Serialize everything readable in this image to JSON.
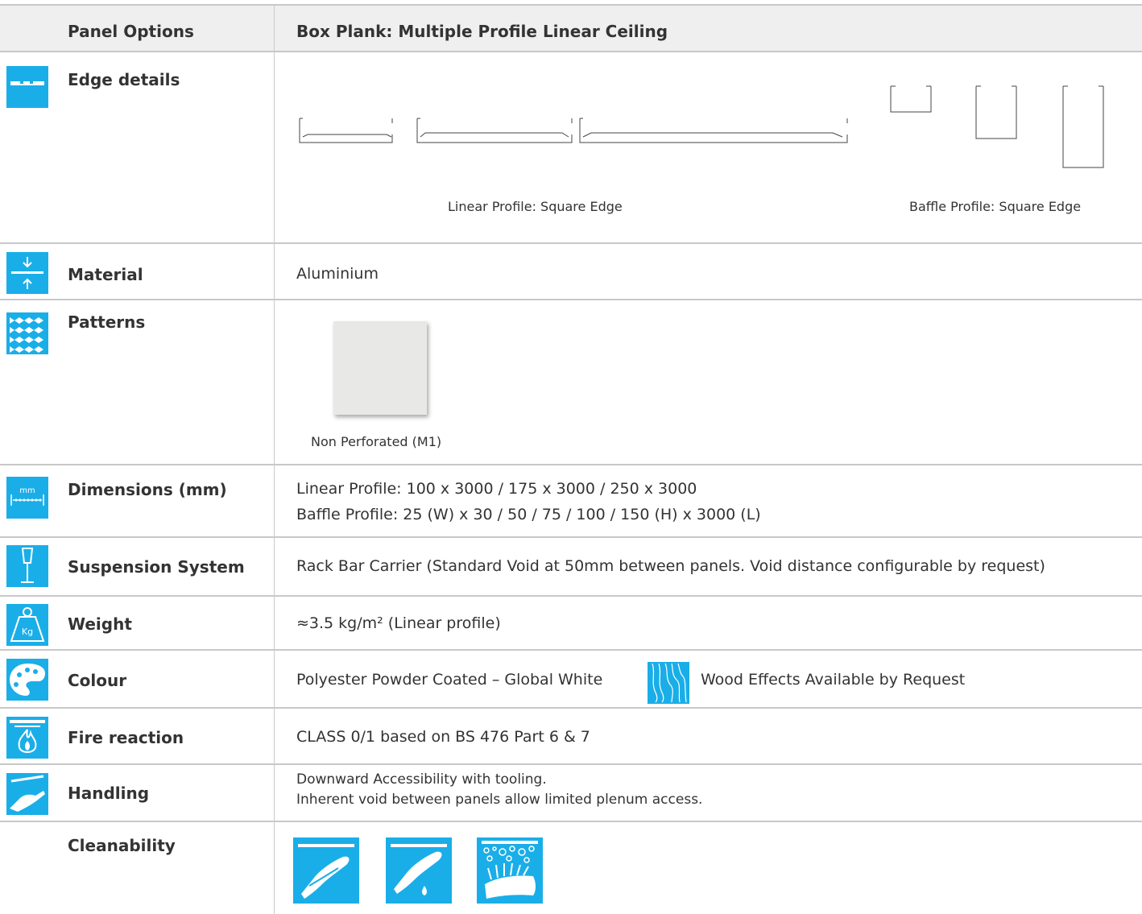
{
  "header": {
    "col1": "Panel Options",
    "col2": "Box Plank: Multiple Profile Linear Ceiling"
  },
  "rows": {
    "edge": {
      "label": "Edge details",
      "icon": "edge-detail-icon",
      "caption_linear": "Linear Profile: Square Edge",
      "caption_baffle": "Baffle Profile: Square Edge"
    },
    "material": {
      "label": "Material",
      "icon": "material-thickness-icon",
      "value": "Aluminium"
    },
    "patterns": {
      "label": "Patterns",
      "icon": "pattern-icon",
      "caption": "Non Perforated (M1)"
    },
    "dimensions": {
      "label": "Dimensions (mm)",
      "icon": "dimensions-mm-icon",
      "icon_text": "mm",
      "line1": "Linear Profile: 100 x 3000 / 175 x 3000 / 250 x 3000",
      "line2": "Baffle Profile: 25 (W) x 30 / 50 / 75 / 100 / 150 (H) x 3000 (L)"
    },
    "suspension": {
      "label": "Suspension System",
      "icon": "suspension-icon",
      "value": "Rack Bar Carrier (Standard Void at 50mm between panels. Void distance configurable by request)"
    },
    "weight": {
      "label": "Weight",
      "icon": "weight-kg-icon",
      "icon_text": "Kg",
      "value": "≈3.5 kg/m² (Linear profile)"
    },
    "colour": {
      "label": "Colour",
      "icon": "palette-icon",
      "value": "Polyester Powder Coated – Global White",
      "wood_icon": "wood-grain-icon",
      "extra": "Wood Effects Available by Request"
    },
    "fire": {
      "label": "Fire reaction",
      "icon": "fire-icon",
      "value": "CLASS 0/1 based on BS 476 Part 6 & 7"
    },
    "handling": {
      "label": "Handling",
      "icon": "hand-handling-icon",
      "line1": "Downward Accessibility with tooling.",
      "line2": "Inherent void between panels allow limited plenum access."
    },
    "cleanability": {
      "label": "Cleanability",
      "icons": [
        "dry-wipe-icon",
        "damp-wipe-icon",
        "scrub-wash-icon"
      ]
    }
  },
  "colors": {
    "accent": "#1aaee8",
    "header_bg": "#efefef",
    "rule": "#c8c8c8",
    "text": "#333333"
  }
}
